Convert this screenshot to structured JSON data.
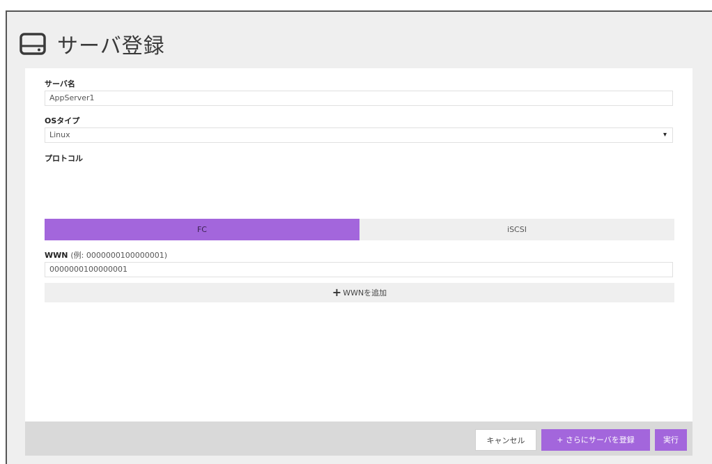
{
  "header": {
    "title": "サーバ登録",
    "icon": "server-icon"
  },
  "form": {
    "server_name": {
      "label": "サーバ名",
      "value": "AppServer1"
    },
    "os_type": {
      "label": "OSタイプ",
      "value": "Linux",
      "arrow": "▾"
    },
    "protocol": {
      "label": "プロトコル",
      "options": [
        "FC",
        "iSCSI"
      ],
      "selected": "FC"
    },
    "wwn": {
      "label": "WWN",
      "hint": "(例: 0000000100000001)",
      "value": "0000000100000001"
    },
    "add_wwn": {
      "plus": "+",
      "label": "WWNを追加"
    }
  },
  "footer": {
    "cancel_label": "キャンセル",
    "register_more_label": "+ さらにサーバを登録",
    "execute_label": "実行"
  },
  "colors": {
    "accent": "#a366dc",
    "panel_bg": "#efefef"
  }
}
